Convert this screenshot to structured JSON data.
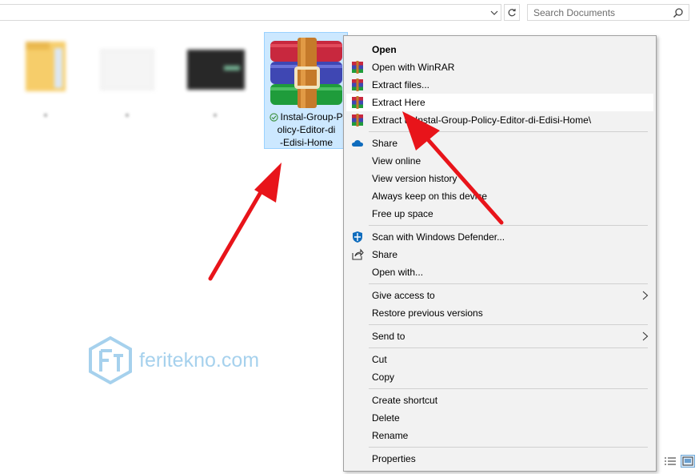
{
  "search": {
    "placeholder": "Search Documents"
  },
  "files": {
    "selected_name": "Instal-Group-Policy-Editor-di-Edisi-Home",
    "selected_name_lines": [
      "Instal-Group-P",
      "olicy-Editor-di",
      "-Edisi-Home"
    ]
  },
  "watermark": {
    "text": "feritekno.com"
  },
  "menu": {
    "items": [
      {
        "label": "Open"
      },
      {
        "label": "Open with WinRAR"
      },
      {
        "label": "Extract files..."
      },
      {
        "label": "Extract Here"
      },
      {
        "label": "Extract to Instal-Group-Policy-Editor-di-Edisi-Home\\"
      },
      {
        "label": "Share"
      },
      {
        "label": "View online"
      },
      {
        "label": "View version history"
      },
      {
        "label": "Always keep on this device"
      },
      {
        "label": "Free up space"
      },
      {
        "label": "Scan with Windows Defender..."
      },
      {
        "label": "Share"
      },
      {
        "label": "Open with..."
      },
      {
        "label": "Give access to"
      },
      {
        "label": "Restore previous versions"
      },
      {
        "label": "Send to"
      },
      {
        "label": "Cut"
      },
      {
        "label": "Copy"
      },
      {
        "label": "Create shortcut"
      },
      {
        "label": "Delete"
      },
      {
        "label": "Rename"
      },
      {
        "label": "Properties"
      }
    ],
    "highlighted": "Extract Here"
  },
  "colors": {
    "arrow": "#e8141a",
    "selection": "#cce8ff",
    "accent": "#0078d7"
  }
}
